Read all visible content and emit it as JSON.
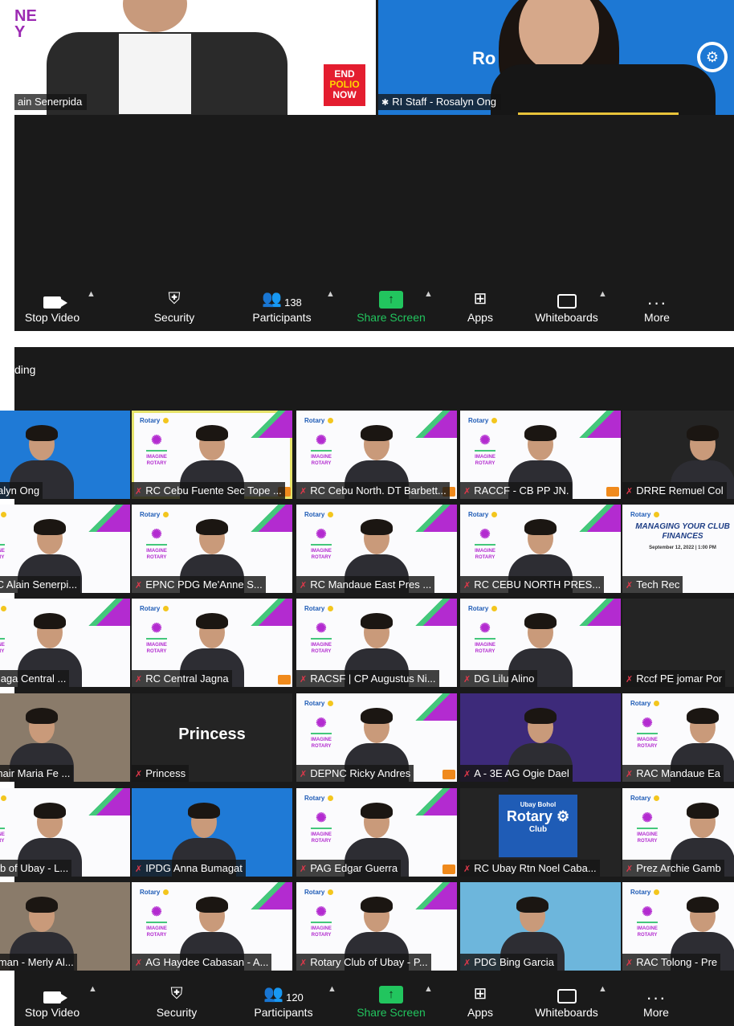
{
  "meeting1": {
    "speaker_left": {
      "name": "ain Senerpida",
      "brand_text": "NE\nY",
      "badge_line1": "END",
      "badge_line2": "POLIO",
      "badge_line3": "NOW"
    },
    "speaker_right": {
      "name": "RI Staff - Rosalyn Ong",
      "background_text": "Ro"
    },
    "toolbar": {
      "stop_video": "Stop Video",
      "security": "Security",
      "participants": "Participants",
      "participants_count": "138",
      "share_screen": "Share Screen",
      "apps": "Apps",
      "whiteboards": "Whiteboards",
      "more": "More"
    }
  },
  "meeting2": {
    "recording_label": "ding",
    "tiles": [
      {
        "label": "- Rosalyn Ong"
      },
      {
        "label": "RC Cebu Fuente Sec Tope ..."
      },
      {
        "label": "RC Cebu North. DT Barbett..."
      },
      {
        "label": "RACCF - CB PP JN."
      },
      {
        "label": "DRRE Remuel Col"
      },
      {
        "label": "F DPC Alain Senerpi..."
      },
      {
        "label": "EPNC PDG  Me'Anne S..."
      },
      {
        "label": "RC Mandaue East Pres ..."
      },
      {
        "label": "RC CEBU NORTH PRES..."
      },
      {
        "label": "Tech Rec",
        "slide_title": "MANAGING YOUR CLUB FINANCES",
        "slide_sub": "September 12, 2022 | 1:00 PM"
      },
      {
        "label": "ebu Naga Central ..."
      },
      {
        "label": "RC Central Jagna"
      },
      {
        "label": "RACSF | CP Augustus Ni..."
      },
      {
        "label": "DG Lilu Alino"
      },
      {
        "label": "Rccf PE jomar Por"
      },
      {
        "label": "RF Chair Maria Fe ..."
      },
      {
        "label": "Princess",
        "center_name": "Princess"
      },
      {
        "label": "DEPNC Ricky Andres"
      },
      {
        "label": "A - 3E  AG  Ogie Dael"
      },
      {
        "label": "RAC Mandaue Ea"
      },
      {
        "label": "ry Club of Ubay - L..."
      },
      {
        "label": "IPDG Anna Bumagat"
      },
      {
        "label": "PAG Edgar Guerra"
      },
      {
        "label": "RC Ubay Rtn Noel Caba...",
        "badge_line1": "Ubay Bohol",
        "badge_line2": "Rotary",
        "badge_line3": "Club"
      },
      {
        "label": "Prez Archie Gamb"
      },
      {
        "label": "Catarman - Merly Al..."
      },
      {
        "label": "AG Haydee Cabasan - A..."
      },
      {
        "label": "Rotary Club of Ubay - P..."
      },
      {
        "label": "PDG Bing Garcia"
      },
      {
        "label": "RAC Tolong - Pre"
      }
    ],
    "toolbar": {
      "stop_video": "Stop Video",
      "security": "Security",
      "participants": "Participants",
      "participants_count": "120",
      "share_screen": "Share Screen",
      "apps": "Apps",
      "whiteboards": "Whiteboards",
      "more": "More"
    }
  },
  "colors": {
    "zoom_bg": "#1a1a1a",
    "share_green": "#22c55e",
    "active_speaker": "#e6e36a",
    "rotary_blue": "#1f7ad6",
    "imagine_purple": "#b32bd0"
  }
}
